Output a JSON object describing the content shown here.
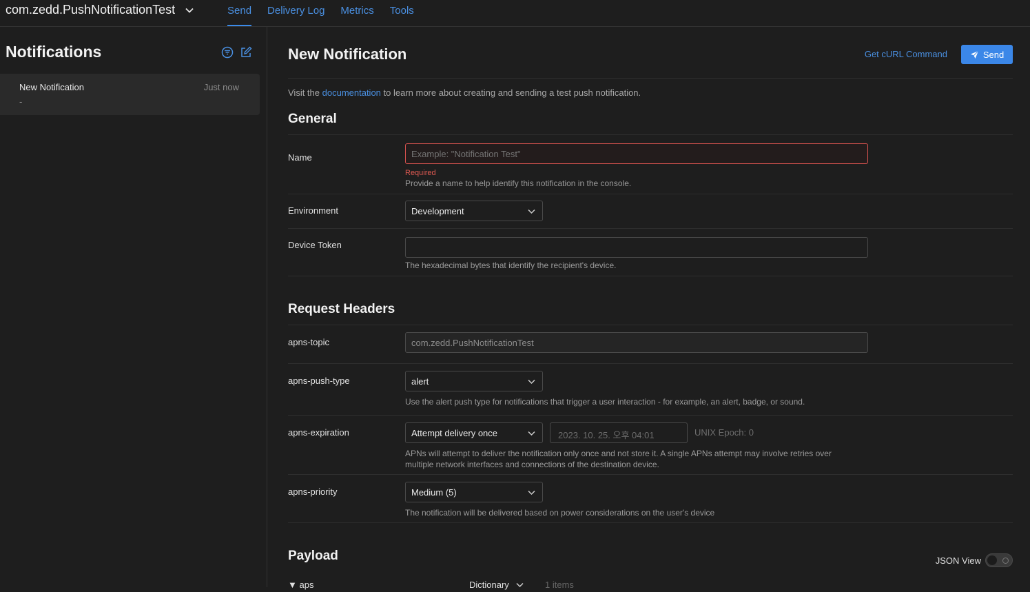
{
  "app": {
    "title": "com.zedd.PushNotificationTest"
  },
  "tabs": [
    {
      "label": "Send",
      "active": true
    },
    {
      "label": "Delivery Log",
      "active": false
    },
    {
      "label": "Metrics",
      "active": false
    },
    {
      "label": "Tools",
      "active": false
    }
  ],
  "sidebar": {
    "title": "Notifications",
    "items": [
      {
        "title": "New Notification",
        "time": "Just now",
        "subtitle": "-"
      }
    ]
  },
  "main": {
    "title": "New Notification",
    "curl_label": "Get cURL Command",
    "send_label": "Send",
    "intro_before": "Visit the ",
    "intro_link": "documentation",
    "intro_after": " to learn more about creating and sending a test push notification."
  },
  "general": {
    "heading": "General",
    "name": {
      "label": "Name",
      "placeholder": "Example: \"Notification Test\"",
      "value": "",
      "error": "Required",
      "help": "Provide a name to help identify this notification in the console."
    },
    "environment": {
      "label": "Environment",
      "value": "Development"
    },
    "device_token": {
      "label": "Device Token",
      "value": "",
      "help": "The hexadecimal bytes that identify the recipient's device."
    }
  },
  "headers": {
    "heading": "Request Headers",
    "topic": {
      "label": "apns-topic",
      "value": "com.zedd.PushNotificationTest"
    },
    "push_type": {
      "label": "apns-push-type",
      "value": "alert",
      "help": "Use the alert push type for notifications that trigger a user interaction - for example, an alert, badge, or sound."
    },
    "expiration": {
      "label": "apns-expiration",
      "value": "Attempt delivery once",
      "date_placeholder": "2023. 10. 25. 오후 04:01",
      "epoch": "UNIX Epoch: 0",
      "help_line1": "APNs will attempt to deliver the notification only once and not store it. A single APNs attempt may involve retries over",
      "help_line2": "multiple network interfaces and connections of the destination device."
    },
    "priority": {
      "label": "apns-priority",
      "value": "Medium (5)",
      "help": "The notification will be delivered based on power considerations on the user's device"
    }
  },
  "payload": {
    "heading": "Payload",
    "json_view_label": "JSON View",
    "json_view_on": false,
    "root": {
      "key": "▼ aps",
      "type": "Dictionary",
      "count": "1 items"
    }
  },
  "colors": {
    "accent": "#3b87e8",
    "link": "#4a90e2",
    "error": "#e05a52",
    "background": "#1e1e1e"
  }
}
